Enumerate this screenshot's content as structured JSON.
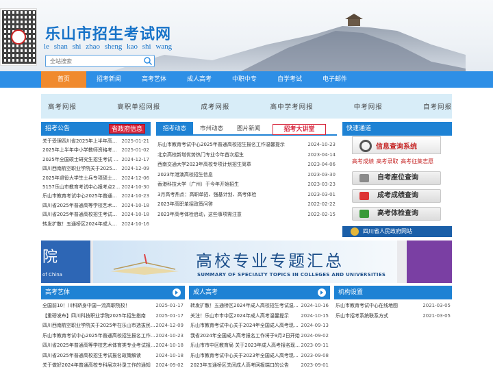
{
  "header": {
    "title": "乐山市招生考试网",
    "pinyin": "le  shan shi  zhao sheng kao shi wang",
    "search_placeholder": "全站搜索"
  },
  "nav": [
    "首页",
    "招考新闻",
    "高考艺体",
    "成人高考",
    "中职中专",
    "自学考试",
    "电子邮件"
  ],
  "exam_bar": [
    "高考网报",
    "高职单招网报",
    "成考网报",
    "高中学考网报",
    "中考网报",
    "自考网报"
  ],
  "announcement": {
    "title": "招考公告",
    "badge": "省政府信息",
    "rows": [
      {
        "t": "关于受理四川省2025年上半年高等教...",
        "d": "2025-01-21"
      },
      {
        "t": "2025年上半年中小学教师资格考试（...",
        "d": "2025-01-02"
      },
      {
        "t": "2025年全国硕士研究生招生考试 515...",
        "d": "2024-12-17"
      },
      {
        "t": "四川西南航空职业学院关于2025年在...",
        "d": "2024-12-09"
      },
      {
        "t": "2025年退役大学生士兵专项硕士研究...",
        "d": "2024-12-06"
      },
      {
        "t": "5157乐山市教育考试中心报考点2025...",
        "d": "2024-10-30"
      },
      {
        "t": "乐山市教育考试中心2025年普通高校...",
        "d": "2024-10-23"
      },
      {
        "t": "四川省2025年普通高等学校艺术体育...",
        "d": "2024-10-18"
      },
      {
        "t": "四川省2025年普通高校招生考试报名...",
        "d": "2024-10-18"
      },
      {
        "t": "转发扩散！五通桥区2024年成人高校招...",
        "d": "2024-10-16"
      }
    ]
  },
  "news": {
    "tabs": [
      "招考动态",
      "市州动态",
      "图片新闻"
    ],
    "special": "招考大讲堂",
    "rows": [
      {
        "t": "乐山市教育考试中心2025年普通高校招生报名工作温馨提示",
        "d": "2024-10-23"
      },
      {
        "t": "北京高校新增优势热门专业今年首次招生",
        "d": "2023-04-14"
      },
      {
        "t": "西南交通大学2023年高校专项计划招生简章",
        "d": "2023-04-06"
      },
      {
        "t": "2023年港澳高校招生信息",
        "d": "2023-03-30"
      },
      {
        "t": "香港科技大学（广州）于今年开始招生",
        "d": "2023-03-23"
      },
      {
        "t": "3月高考热点：高职单招、强基计划、高考体检",
        "d": "2023-03-01"
      },
      {
        "t": "2023年高职单招政策问答",
        "d": "2022-02-22"
      },
      {
        "t": "2023年高考体检启动，这些事项需注意",
        "d": "2022-02-15"
      }
    ]
  },
  "quick": {
    "title": "快速通道",
    "info_query": "信息查询系统",
    "links": "高考成绩  高考录取  高考征集志愿",
    "seat": "自考座位查询",
    "score": "成考成绩查询",
    "physical": "高考体检查询",
    "gov": "四川省人民政府网站"
  },
  "banner": {
    "left_big": "院",
    "left_small": "of China",
    "title": "高校专业专题汇总",
    "subtitle": "SUMMARY OF SPECIALTY TOPICS IN COLLEGES AND UNIVERSITIES"
  },
  "art": {
    "title": "高考艺体",
    "rows": [
      {
        "t": "全国前10！川科跻身中国一流高职院校！",
        "d": "2025-01-17"
      },
      {
        "t": "【重磅发布】四川科技职业学院2025年招生指南",
        "d": "2025-01-17"
      },
      {
        "t": "四川西南航空职业学院关于2025年在乐山市选拔民航...",
        "d": "2024-12-09"
      },
      {
        "t": "乐山市教育考试中心2025年普通高校招生报名工作温...",
        "d": "2024-10-23"
      },
      {
        "t": "四川省2025年普通高等学校艺术体育类专业考试报名...",
        "d": "2024-10-18"
      },
      {
        "t": "四川省2025年普通高校招生考试报名政策解读",
        "d": "2024-10-18"
      },
      {
        "t": "关于做好2024年普通高校专科层次补录工作的通知",
        "d": "2024-09-02"
      }
    ]
  },
  "adult": {
    "title": "成人高考",
    "rows": [
      {
        "t": "转发扩散！五通桥区2024年成人高校招生考试温馨提示",
        "d": "2024-10-16"
      },
      {
        "t": "关注！乐山市市中区2024年成人高考温馨提示",
        "d": "2024-10-15"
      },
      {
        "t": "乐山市教育考试中心关于2024年全国成人高考现场确...",
        "d": "2024-09-13"
      },
      {
        "t": "我省2024年全国成人高考报名工作将于9月2日开始",
        "d": "2024-09-02"
      },
      {
        "t": "乐山市市中区教育局 关于2023年成人高考报名现场...",
        "d": "2023-09-11"
      },
      {
        "t": "乐山市教育考试中心关于2023年全国成人高考现场确...",
        "d": "2023-09-08"
      },
      {
        "t": "2023年五通桥区关闭成人高考网报端口的公告",
        "d": "2023-09-01"
      }
    ]
  },
  "org": {
    "title": "机构设置",
    "rows": [
      {
        "t": "乐山市教育考试中心在线地图",
        "d": "2021-03-05"
      },
      {
        "t": "乐山市招考系统联系方式",
        "d": "2021-03-05"
      }
    ]
  }
}
